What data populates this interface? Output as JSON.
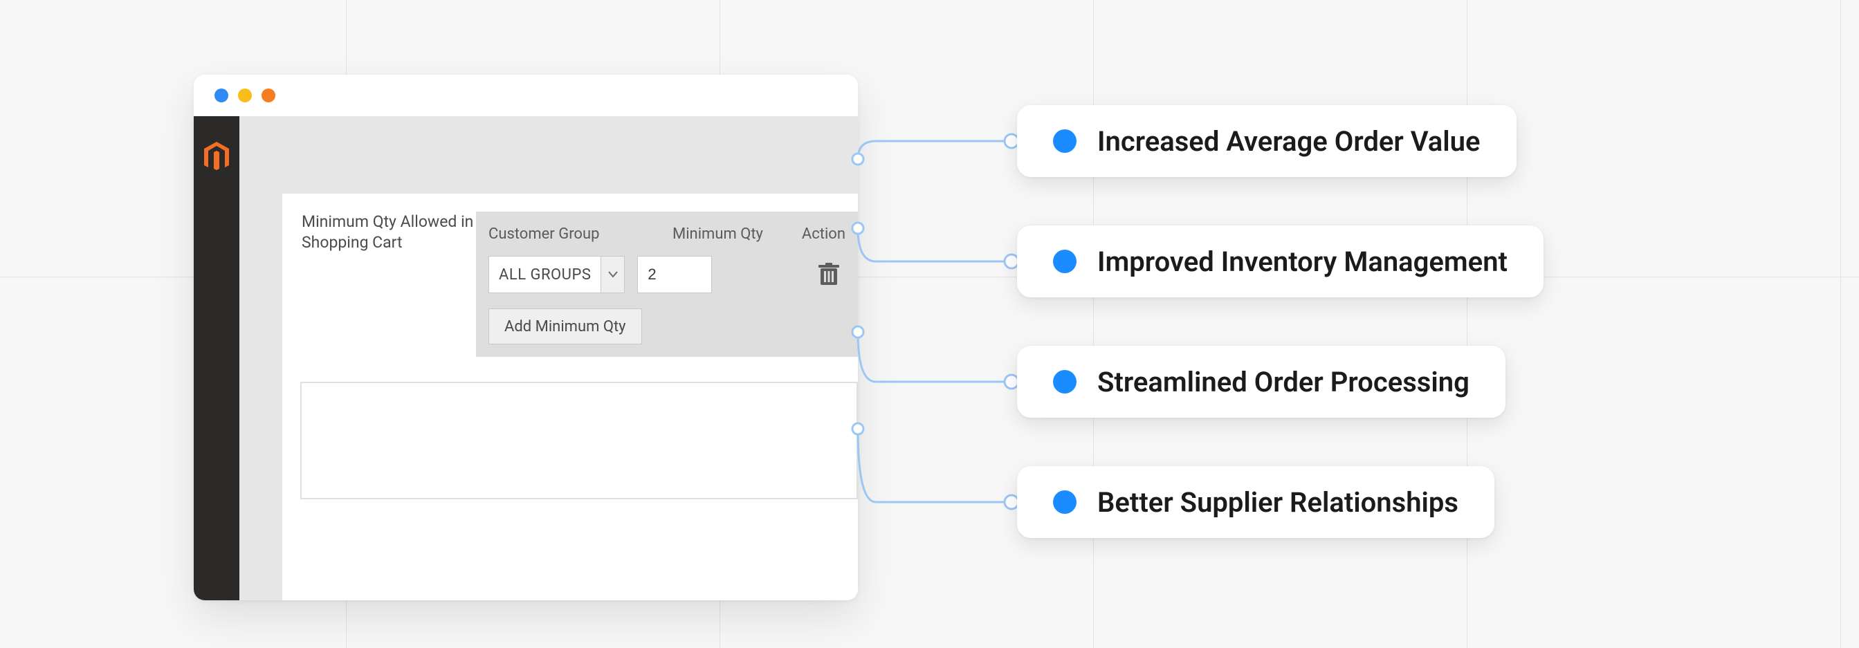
{
  "window": {
    "config_label": "Minimum Qty Allowed in Shopping Cart",
    "table": {
      "head_group": "Customer Group",
      "head_min": "Minimum Qty",
      "head_action": "Action",
      "row": {
        "group": "ALL GROUPS",
        "min_qty": "2"
      },
      "add_button": "Add Minimum Qty"
    }
  },
  "benefits": [
    "Increased Average Order Value",
    "Improved Inventory Management",
    "Streamlined Order Processing",
    "Better Supplier Relationships"
  ],
  "colors": {
    "accent_blue": "#1a8cff",
    "wire": "#9cc6f4",
    "rail": "#2b2a29",
    "magento": "#f46f25"
  }
}
